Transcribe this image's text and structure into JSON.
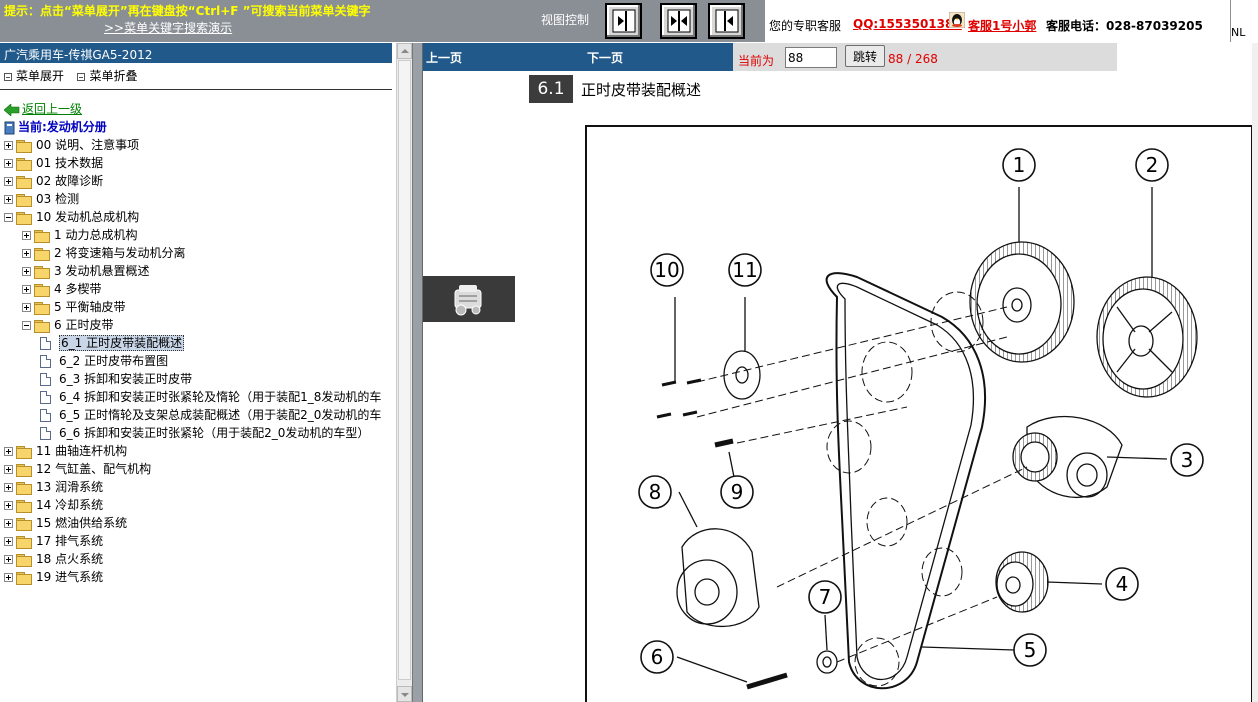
{
  "topbar": {
    "tip": "提示：点击“菜单展开”再在键盘按“Ctrl+F ”可搜索当前菜单关键字",
    "demo_link": ">>菜单关键字搜索演示",
    "view_label": "视图控制",
    "service_label": "您的专职客服",
    "service_qq": "QQ:1553501388",
    "service_name": "客服1号小郭",
    "service_phone": "客服电话：028-87039205",
    "corner_text": "NL"
  },
  "sidebar": {
    "title": "广汽乘用车-传祺GA5-2012",
    "expand_label": "菜单展开",
    "collapse_label": "菜单折叠",
    "back_label": "返回上一级",
    "current_label": "当前:发动机分册",
    "items": [
      {
        "label": "00 说明、注意事项",
        "level": 0,
        "type": "folder",
        "expanded": false
      },
      {
        "label": "01 技术数据",
        "level": 0,
        "type": "folder",
        "expanded": false
      },
      {
        "label": "02 故障诊断",
        "level": 0,
        "type": "folder",
        "expanded": false
      },
      {
        "label": "03 检测",
        "level": 0,
        "type": "folder",
        "expanded": false
      },
      {
        "label": "10 发动机总成机构",
        "level": 0,
        "type": "folder",
        "expanded": true
      },
      {
        "label": "1 动力总成机构",
        "level": 1,
        "type": "folder",
        "expanded": false
      },
      {
        "label": "2 将变速箱与发动机分离",
        "level": 1,
        "type": "folder",
        "expanded": false
      },
      {
        "label": "3 发动机悬置概述",
        "level": 1,
        "type": "folder",
        "expanded": false
      },
      {
        "label": "4 多楔带",
        "level": 1,
        "type": "folder",
        "expanded": false
      },
      {
        "label": "5 平衡轴皮带",
        "level": 1,
        "type": "folder",
        "expanded": false
      },
      {
        "label": "6 正时皮带",
        "level": 1,
        "type": "folder",
        "expanded": true
      },
      {
        "label": "6_1 正时皮带装配概述",
        "level": 2,
        "type": "doc",
        "selected": true
      },
      {
        "label": "6_2 正时皮带布置图",
        "level": 2,
        "type": "doc"
      },
      {
        "label": "6_3 拆卸和安装正时皮带",
        "level": 2,
        "type": "doc"
      },
      {
        "label": "6_4 拆卸和安装正时张紧轮及惰轮（用于装配1_8发动机的车",
        "level": 2,
        "type": "doc"
      },
      {
        "label": "6_5 正时惰轮及支架总成装配概述（用于装配2_0发动机的车",
        "level": 2,
        "type": "doc"
      },
      {
        "label": "6_6 拆卸和安装正时张紧轮（用于装配2_0发动机的车型）",
        "level": 2,
        "type": "doc"
      },
      {
        "label": "11 曲轴连杆机构",
        "level": 0,
        "type": "folder",
        "expanded": false
      },
      {
        "label": "12 气缸盖、配气机构",
        "level": 0,
        "type": "folder",
        "expanded": false
      },
      {
        "label": "13 润滑系统",
        "level": 0,
        "type": "folder",
        "expanded": false
      },
      {
        "label": "14 冷却系统",
        "level": 0,
        "type": "folder",
        "expanded": false
      },
      {
        "label": "15 燃油供给系统",
        "level": 0,
        "type": "folder",
        "expanded": false
      },
      {
        "label": "17 排气系统",
        "level": 0,
        "type": "folder",
        "expanded": false
      },
      {
        "label": "18 点火系统",
        "level": 0,
        "type": "folder",
        "expanded": false
      },
      {
        "label": "19 进气系统",
        "level": 0,
        "type": "folder",
        "expanded": false
      }
    ]
  },
  "content": {
    "prev_label": "上一页",
    "next_label": "下一页",
    "current_page_label": "当前为",
    "page_value": "88",
    "jump_label": "跳转",
    "page_total": "88 / 268",
    "section_number": "6.1",
    "section_title": "正时皮带装配概述",
    "callouts": [
      "1",
      "2",
      "3",
      "4",
      "5",
      "6",
      "7",
      "8",
      "9",
      "10",
      "11"
    ]
  }
}
